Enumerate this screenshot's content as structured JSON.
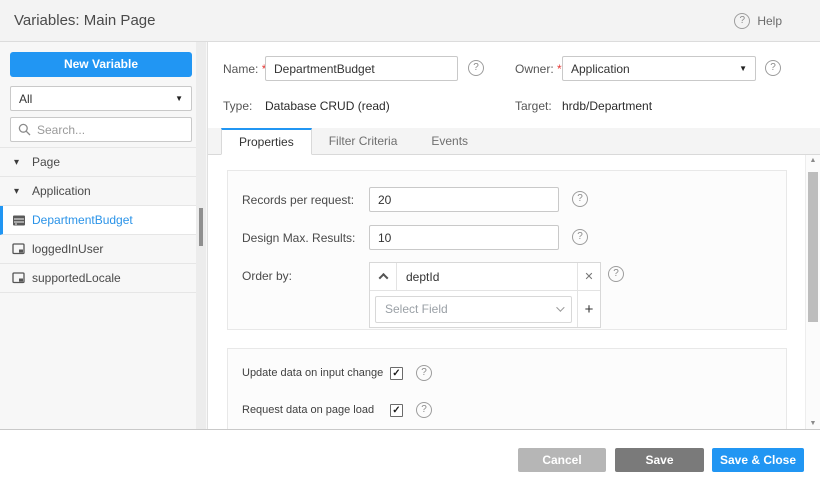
{
  "window": {
    "title": "Variables: Main Page"
  },
  "header": {
    "help_label": "Help"
  },
  "sidebar": {
    "new_variable_button": "New Variable",
    "filter_select_value": "All",
    "search_placeholder": "Search...",
    "tree": [
      {
        "label": "Page",
        "type": "group",
        "expanded": true
      },
      {
        "label": "Application",
        "type": "group",
        "expanded": true
      },
      {
        "label": "DepartmentBudget",
        "type": "crud-variable",
        "selected": true
      },
      {
        "label": "loggedInUser",
        "type": "static-variable",
        "selected": false
      },
      {
        "label": "supportedLocale",
        "type": "static-variable",
        "selected": false
      }
    ]
  },
  "details": {
    "name_label": "Name:",
    "required_marker": "*",
    "name_value": "DepartmentBudget",
    "owner_label": "Owner:",
    "owner_value": "Application",
    "type_label": "Type:",
    "type_value": "Database CRUD (read)",
    "target_label": "Target:",
    "target_value": "hrdb/Department"
  },
  "tabs": {
    "properties": "Properties",
    "filter_criteria": "Filter Criteria",
    "events": "Events",
    "active_tab": "Properties"
  },
  "properties_panel": {
    "records_per_request_label": "Records per request:",
    "records_per_request_value": "20",
    "design_max_results_label": "Design Max. Results:",
    "design_max_results_value": "10",
    "order_by_label": "Order by:",
    "order_by_field": "deptId",
    "select_field_placeholder": "Select Field"
  },
  "behavior_panel": {
    "update_on_input_label": "Update data on input change",
    "update_on_input_checked": true,
    "request_on_load_label": "Request data on page load",
    "request_on_load_checked": true
  },
  "footer": {
    "cancel": "Cancel",
    "save": "Save",
    "save_and_close": "Save & Close"
  },
  "icons": {
    "help_glyph": "?",
    "caret_down": "▼",
    "tree_expanded_glyph": "▾",
    "remove_glyph": "✕",
    "add_glyph": "+",
    "scroll_up_glyph": "▲",
    "scroll_down_glyph": "▼",
    "check_glyph": "✓"
  },
  "colors": {
    "accent_blue": "#2196f3",
    "save_gray": "#7a7a7a",
    "cancel_gray": "#b6b6b6",
    "selected_item_text": "#2a93e8"
  }
}
